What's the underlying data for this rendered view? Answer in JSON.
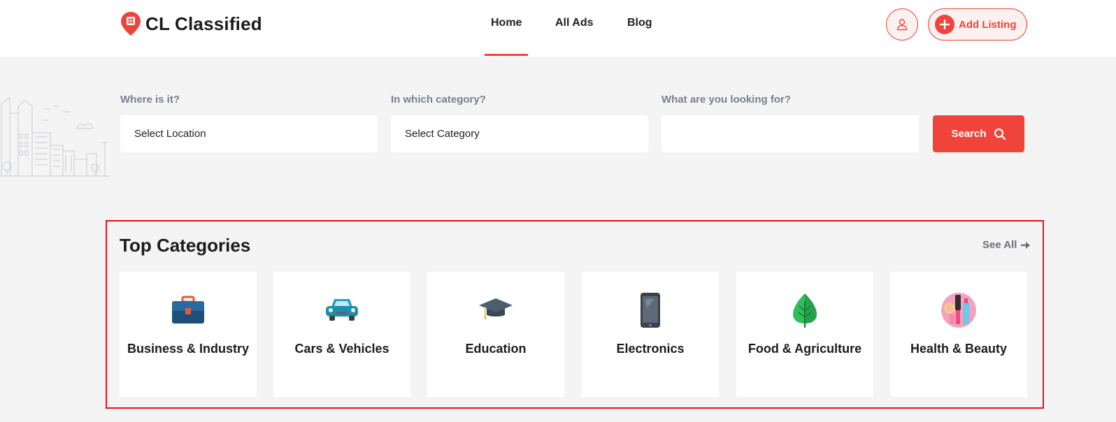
{
  "app": {
    "name": "CL Classified"
  },
  "nav": {
    "items": [
      {
        "label": "Home",
        "active": true
      },
      {
        "label": "All Ads",
        "active": false
      },
      {
        "label": "Blog",
        "active": false
      }
    ],
    "accent_color": "#f0443a"
  },
  "header": {
    "user_icon": "user-icon",
    "add_listing_label": "Add Listing"
  },
  "search": {
    "location": {
      "label": "Where is it?",
      "value": "Select Location"
    },
    "category": {
      "label": "In which category?",
      "value": "Select Category"
    },
    "keyword": {
      "label": "What are you looking for?",
      "value": ""
    },
    "button_label": "Search"
  },
  "categories": {
    "title": "Top Categories",
    "see_all_label": "See All",
    "items": [
      {
        "label": "Business & Industry",
        "icon": "briefcase-icon"
      },
      {
        "label": "Cars & Vehicles",
        "icon": "car-icon"
      },
      {
        "label": "Education",
        "icon": "graduation-cap-icon"
      },
      {
        "label": "Electronics",
        "icon": "smartphone-icon"
      },
      {
        "label": "Food & Agriculture",
        "icon": "leaf-icon"
      },
      {
        "label": "Health & Beauty",
        "icon": "cosmetics-icon"
      }
    ]
  }
}
